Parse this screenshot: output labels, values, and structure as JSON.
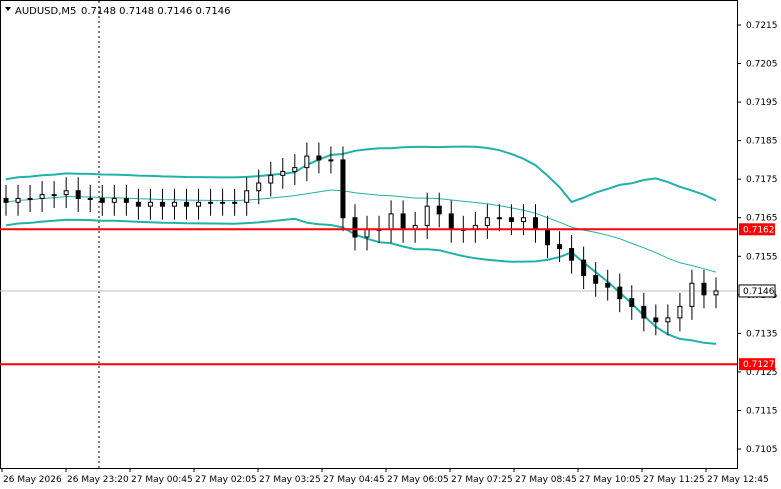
{
  "header": {
    "symbol_label": "AUDUSD,M5",
    "ohlc_label": "0.7148 0.7148 0.7146 0.7146"
  },
  "colors": {
    "background": "#ffffff",
    "candle": "#000000",
    "bollinger_band": "#20b2aa",
    "support_resistance": "#ff0000",
    "current_price_line": "#c0c0c0"
  },
  "icons": {
    "dropdown": "triangle-down-icon"
  },
  "chart_data": {
    "type": "candlestick",
    "price_axis": {
      "ylim": [
        0.71,
        0.722
      ],
      "ticks": [
        "0.7215",
        "0.7205",
        "0.7195",
        "0.7185",
        "0.7175",
        "0.7165",
        "0.7155",
        "0.7145",
        "0.7135",
        "0.7125",
        "0.7115",
        "0.7105"
      ]
    },
    "time_axis": {
      "ticks": [
        "26 May 2026",
        "26 May 23:20",
        "27 May 00:45",
        "27 May 02:05",
        "27 May 03:25",
        "27 May 04:45",
        "27 May 06:05",
        "27 May 07:25",
        "27 May 08:45",
        "27 May 10:05",
        "27 May 11:25",
        "27 May 12:45"
      ]
    },
    "horizontal_levels": [
      {
        "value": 0.7162,
        "label": "0.7162"
      },
      {
        "value": 0.7127,
        "label": "0.7127"
      }
    ],
    "current_price": {
      "value": 0.7146,
      "label": "0.7146"
    },
    "closes": [
      0.7169,
      0.717,
      0.717,
      0.7171,
      0.7171,
      0.7172,
      0.717,
      0.717,
      0.7169,
      0.717,
      0.7169,
      0.7168,
      0.7169,
      0.7168,
      0.7169,
      0.7168,
      0.7169,
      0.7169,
      0.7169,
      0.7169,
      0.7172,
      0.7174,
      0.7176,
      0.7177,
      0.7178,
      0.7181,
      0.718,
      0.718,
      0.7165,
      0.716,
      0.7162,
      0.7162,
      0.7166,
      0.7162,
      0.7163,
      0.7168,
      0.7166,
      0.7162,
      0.7162,
      0.7163,
      0.7165,
      0.7165,
      0.7164,
      0.7165,
      0.7162,
      0.7158,
      0.7157,
      0.7154,
      0.715,
      0.7148,
      0.7147,
      0.7144,
      0.7142,
      0.7139,
      0.7138,
      0.7139,
      0.7142,
      0.7148,
      0.7145,
      0.7146
    ]
  }
}
